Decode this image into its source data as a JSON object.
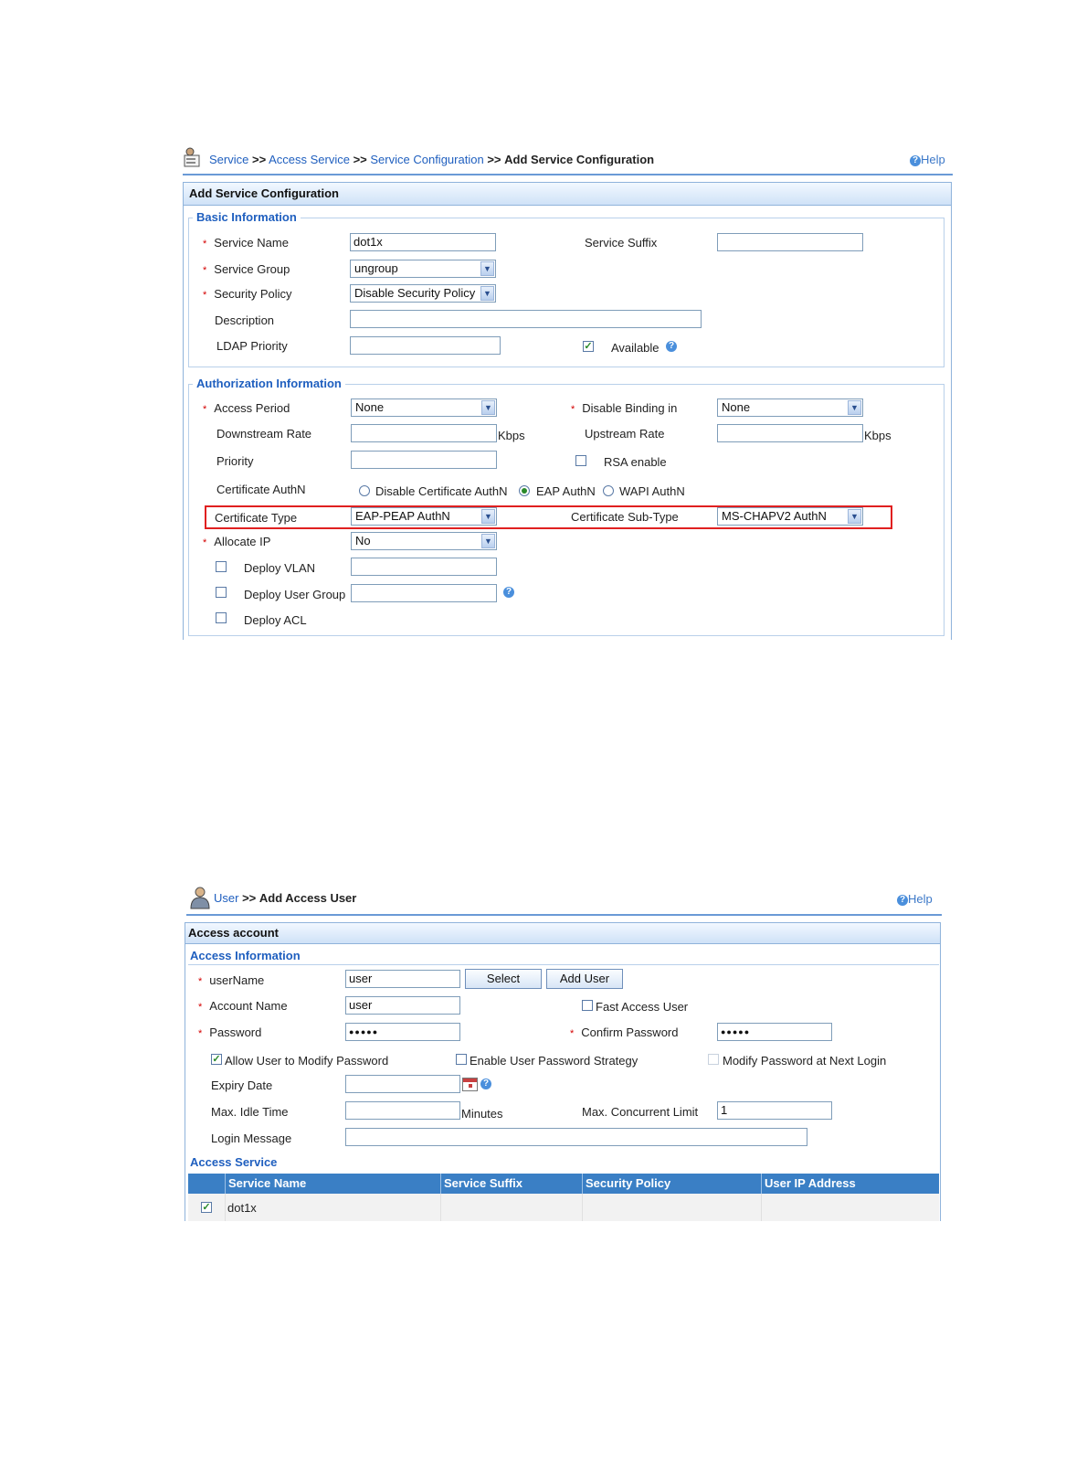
{
  "screen1": {
    "breadcrumb": {
      "items": [
        "Service",
        "Access Service",
        "Service Configuration"
      ],
      "separator": ">>",
      "current": "Add Service Configuration"
    },
    "help": "Help",
    "panel_title": "Add Service Configuration",
    "basic": {
      "legend": "Basic Information",
      "service_name_label": "Service Name",
      "service_name_value": "dot1x",
      "service_suffix_label": "Service Suffix",
      "service_suffix_value": "",
      "service_group_label": "Service Group",
      "service_group_value": "ungroup",
      "security_policy_label": "Security Policy",
      "security_policy_value": "Disable Security Policy",
      "description_label": "Description",
      "description_value": "",
      "ldap_priority_label": "LDAP Priority",
      "ldap_priority_value": "",
      "available_label": "Available",
      "available_checked": true
    },
    "auth": {
      "legend": "Authorization Information",
      "access_period_label": "Access Period",
      "access_period_value": "None",
      "disable_binding_label": "Disable Binding in",
      "disable_binding_value": "None",
      "downstream_label": "Downstream Rate",
      "downstream_value": "",
      "kbps": "Kbps",
      "upstream_label": "Upstream Rate",
      "upstream_value": "",
      "priority_label": "Priority",
      "priority_value": "",
      "rsa_label": "RSA enable",
      "rsa_checked": false,
      "cert_authn_label": "Certificate AuthN",
      "cert_authn_options": [
        "Disable Certificate AuthN",
        "EAP AuthN",
        "WAPI AuthN"
      ],
      "cert_authn_selected": "EAP AuthN",
      "cert_type_label": "Certificate Type",
      "cert_type_value": "EAP-PEAP AuthN",
      "cert_subtype_label": "Certificate Sub-Type",
      "cert_subtype_value": "MS-CHAPV2 AuthN",
      "allocate_ip_label": "Allocate IP",
      "allocate_ip_value": "No",
      "deploy_vlan_label": "Deploy VLAN",
      "deploy_user_group_label": "Deploy User Group",
      "deploy_acl_label": "Deploy ACL"
    }
  },
  "screen2": {
    "breadcrumb": {
      "items": [
        "User"
      ],
      "separator": ">>",
      "current": "Add Access User"
    },
    "help": "Help",
    "panel_title": "Access account",
    "access_info": {
      "legend": "Access Information",
      "username_label": "userName",
      "username_value": "user",
      "select_button": "Select",
      "add_user_button": "Add User",
      "account_name_label": "Account Name",
      "account_name_value": "user",
      "fast_access_label": "Fast Access User",
      "password_label": "Password",
      "password_value": "●●●●●",
      "confirm_password_label": "Confirm Password",
      "confirm_password_value": "●●●●●",
      "allow_modify_label": "Allow User to Modify Password",
      "allow_modify_checked": true,
      "enable_strategy_label": "Enable User Password Strategy",
      "modify_next_login_label": "Modify Password at Next Login",
      "expiry_label": "Expiry Date",
      "max_idle_label": "Max. Idle Time",
      "minutes": "Minutes",
      "max_concurrent_label": "Max. Concurrent Limit",
      "max_concurrent_value": "1",
      "login_message_label": "Login Message"
    },
    "access_service": {
      "legend": "Access Service",
      "columns": [
        "Service Name",
        "Service Suffix",
        "Security Policy",
        "User IP Address"
      ],
      "rows": [
        {
          "checked": true,
          "service_name": "dot1x"
        }
      ]
    }
  }
}
